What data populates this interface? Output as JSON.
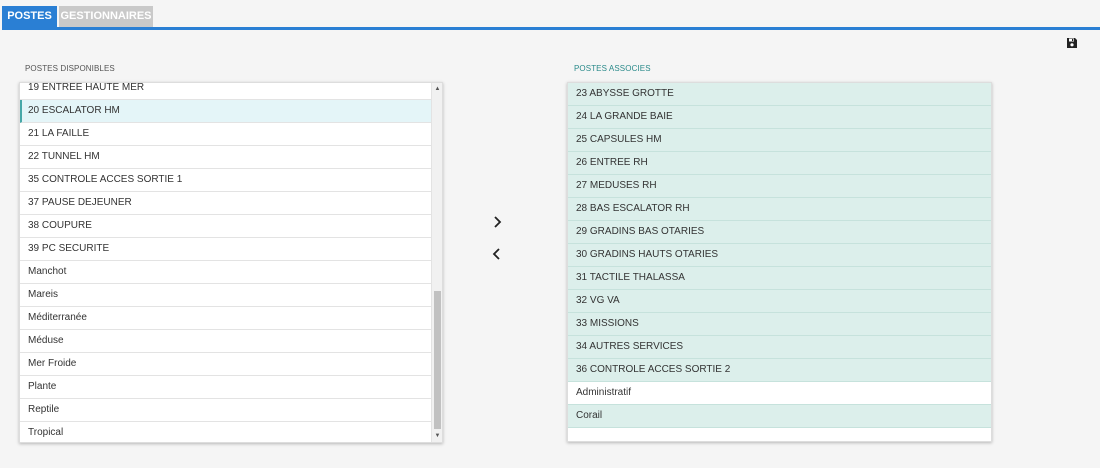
{
  "tabs": [
    {
      "label": "POSTES",
      "active": true
    },
    {
      "label": "GESTIONNAIRES",
      "active": false
    }
  ],
  "icons": {
    "save": "floppy-disk-icon",
    "move_right": "chevron-right-icon",
    "move_left": "chevron-left-icon"
  },
  "colors": {
    "accent": "#2a7fd4",
    "associated_row_bg": "#dcefeb",
    "selected_row_bg": "#e4f5f8"
  },
  "available": {
    "label": "POSTES DISPONIBLES",
    "selected_item": "20 ESCALATOR HM",
    "items": [
      "19 ENTREE HAUTE MER",
      "20 ESCALATOR HM",
      "21 LA FAILLE",
      "22 TUNNEL HM",
      "35 CONTROLE ACCES SORTIE 1",
      "37 PAUSE DEJEUNER",
      "38 COUPURE",
      "39 PC SECURITE",
      "Manchot",
      "Mareis",
      "Méditerranée",
      "Méduse",
      "Mer Froide",
      "Plante",
      "Reptile",
      "Tropical"
    ]
  },
  "associated": {
    "label": "POSTES ASSOCIES",
    "items": [
      "23 ABYSSE GROTTE",
      "24 LA GRANDE BAIE",
      "25 CAPSULES HM",
      "26 ENTREE RH",
      "27 MEDUSES RH",
      "28 BAS ESCALATOR RH",
      "29 GRADINS BAS OTARIES",
      "30 GRADINS HAUTS OTARIES",
      "31 TACTILE THALASSA",
      "32 VG VA",
      "33 MISSIONS",
      "34 AUTRES SERVICES",
      "36 CONTROLE ACCES SORTIE 2",
      "Administratif",
      "Corail"
    ],
    "plain_items": [
      "Administratif"
    ]
  }
}
